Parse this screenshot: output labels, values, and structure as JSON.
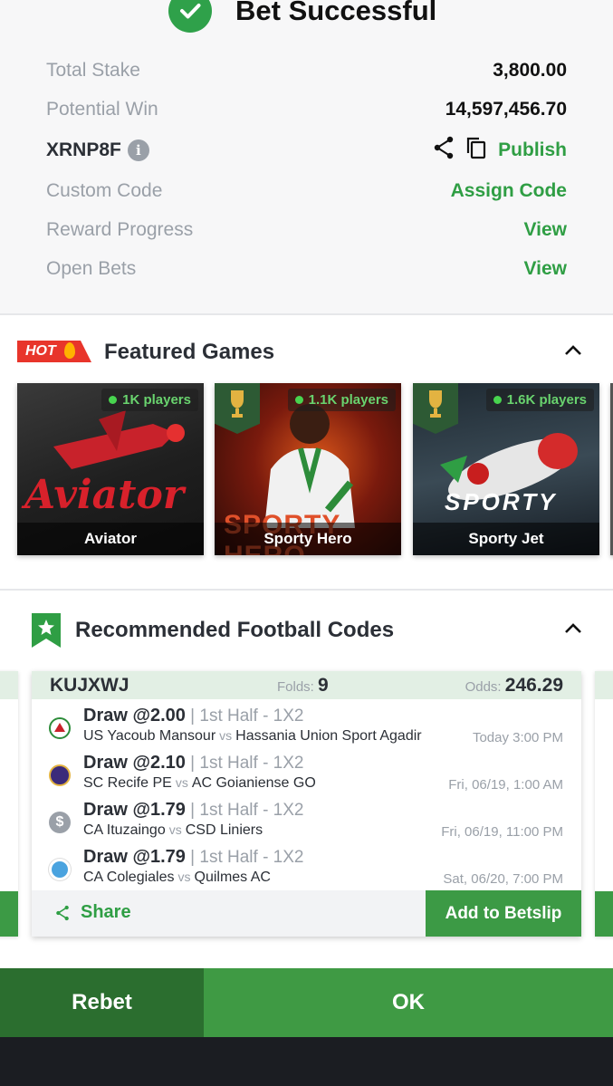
{
  "header": {
    "title": "Bet Successful"
  },
  "summary": {
    "total_stake_label": "Total Stake",
    "total_stake_value": "3,800.00",
    "potential_win_label": "Potential Win",
    "potential_win_value": "14,597,456.70",
    "booking_code": "XRNP8F",
    "publish_label": "Publish",
    "custom_code_label": "Custom Code",
    "assign_code_label": "Assign Code",
    "reward_progress_label": "Reward Progress",
    "reward_view_label": "View",
    "open_bets_label": "Open Bets",
    "open_bets_view_label": "View"
  },
  "featured": {
    "hot_label": "HOT",
    "title": "Featured Games",
    "games": [
      {
        "name": "Aviator",
        "players": "1K players",
        "art_text": "Aviator"
      },
      {
        "name": "Sporty Hero",
        "players": "1.1K players",
        "art_text": "SPORTY HERO"
      },
      {
        "name": "Sporty Jet",
        "players": "1.6K players",
        "art_text": "SPORTY"
      }
    ]
  },
  "recommended": {
    "title": "Recommended Football Codes",
    "card": {
      "code": "KUJXWJ",
      "folds_label": "Folds:",
      "folds_value": "9",
      "odds_label": "Odds:",
      "odds_value": "246.29",
      "vs_label": "vs",
      "matches": [
        {
          "pick": "Draw @2.00",
          "market": "| 1st Half - 1X2",
          "home": "US Yacoub Mansour",
          "away": "Hassania Union Sport Agadir",
          "time": "Today 3:00 PM"
        },
        {
          "pick": "Draw @2.10",
          "market": "| 1st Half - 1X2",
          "home": "SC Recife PE",
          "away": "AC Goianiense GO",
          "time": "Fri, 06/19, 1:00 AM"
        },
        {
          "pick": "Draw @1.79",
          "market": "| 1st Half - 1X2",
          "home": "CA Ituzaingo",
          "away": "CSD Liniers",
          "time": "Fri, 06/19, 11:00 PM"
        },
        {
          "pick": "Draw @1.79",
          "market": "| 1st Half - 1X2",
          "home": "CA Colegiales",
          "away": "Quilmes AC",
          "time": "Sat, 06/20, 7:00 PM"
        }
      ],
      "share_label": "Share",
      "add_label": "Add to Betslip"
    }
  },
  "actions": {
    "rebet_label": "Rebet",
    "ok_label": "OK"
  },
  "colors": {
    "accent_green": "#2f9e44",
    "dark_green": "#2b6e2f",
    "hot_red": "#e8352b"
  }
}
